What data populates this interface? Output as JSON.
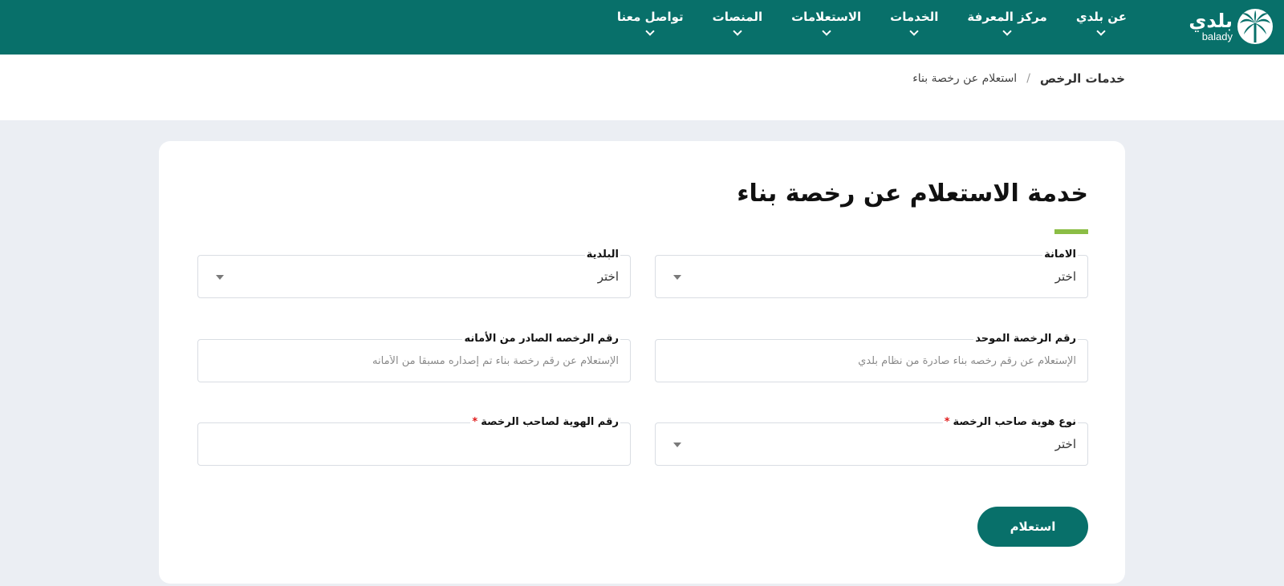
{
  "header": {
    "logo": {
      "ar": "بلدي",
      "en": "balady"
    },
    "nav": [
      {
        "label": "عن بلدي"
      },
      {
        "label": "مركز المعرفة"
      },
      {
        "label": "الخدمات"
      },
      {
        "label": "الاستعلامات"
      },
      {
        "label": "المنصات"
      },
      {
        "label": "تواصل معنا"
      }
    ]
  },
  "breadcrumb": {
    "root": "خدمات الرخص",
    "separator": "/",
    "current": "استعلام عن رخصة بناء"
  },
  "page": {
    "title": "خدمة الاستعلام عن رخصة بناء",
    "fields": {
      "amana": {
        "label": "الامانة",
        "value": "اختر"
      },
      "baladia": {
        "label": "البلدية",
        "value": "اختر"
      },
      "unified_license": {
        "label": "رقم الرخصة الموحد",
        "placeholder": "الإستعلام عن رقم رخصه بناء صادرة من نظام بلدي"
      },
      "issued_license": {
        "label": "رقم الرخصه الصادر من الأمانه",
        "placeholder": "الإستعلام عن رقم رخصة بناء تم إصداره مسبقا من الأمانه"
      },
      "id_type": {
        "label": "نوع هوية صاحب الرخصة",
        "required_mark": "*",
        "value": "اختر"
      },
      "id_number": {
        "label": "رقم الهوية لصاحب الرخصة",
        "required_mark": "*",
        "placeholder": ""
      }
    },
    "submit_label": "استعلام"
  },
  "colors": {
    "brand": "#08706a",
    "accent": "#8bbd45",
    "required": "#e01b1b"
  },
  "icons": {
    "logo": "palm-tree-icon",
    "nav_chevron": "chevron-down-icon",
    "select_caret": "caret-down-icon"
  }
}
